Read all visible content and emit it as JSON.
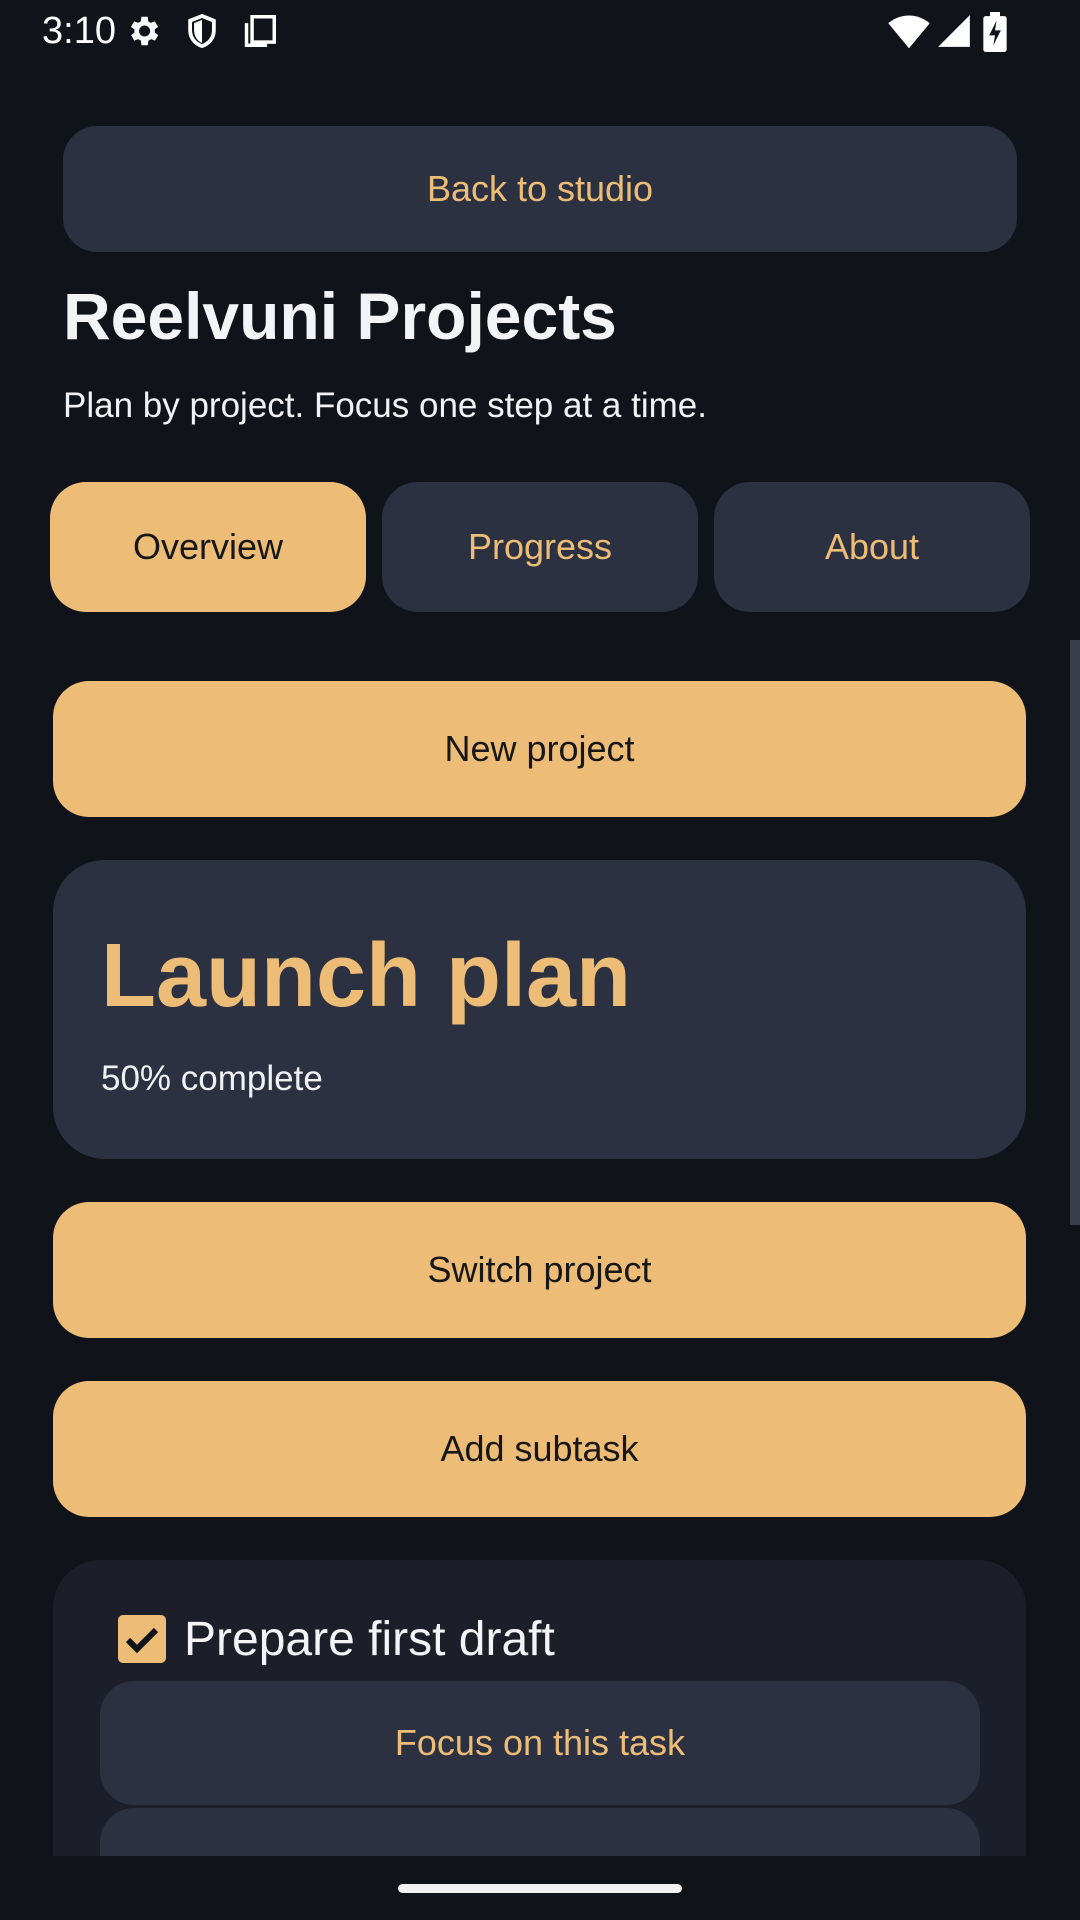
{
  "status_bar": {
    "time": "3:10",
    "icons_left": [
      "gear-icon",
      "shield-icon",
      "copy-icon"
    ],
    "icons_right": [
      "wifi-icon",
      "cell-signal-icon",
      "battery-charging-icon"
    ]
  },
  "header": {
    "back_label": "Back to studio",
    "title": "Reelvuni Projects",
    "subtitle": "Plan by project. Focus one step at a time."
  },
  "tabs": [
    {
      "label": "Overview",
      "active": true
    },
    {
      "label": "Progress",
      "active": false
    },
    {
      "label": "About",
      "active": false
    }
  ],
  "actions": {
    "new_project": "New project",
    "switch_project": "Switch project",
    "add_subtask": "Add subtask"
  },
  "project": {
    "name": "Launch plan",
    "progress_text": "50% complete"
  },
  "tasks": [
    {
      "label": "Prepare first draft",
      "checked": true,
      "focus_label": "Focus on this task"
    }
  ],
  "colors": {
    "background": "#11131b",
    "surface": "#2c3142",
    "accent": "#edbd78",
    "text": "#f2f2f5"
  }
}
